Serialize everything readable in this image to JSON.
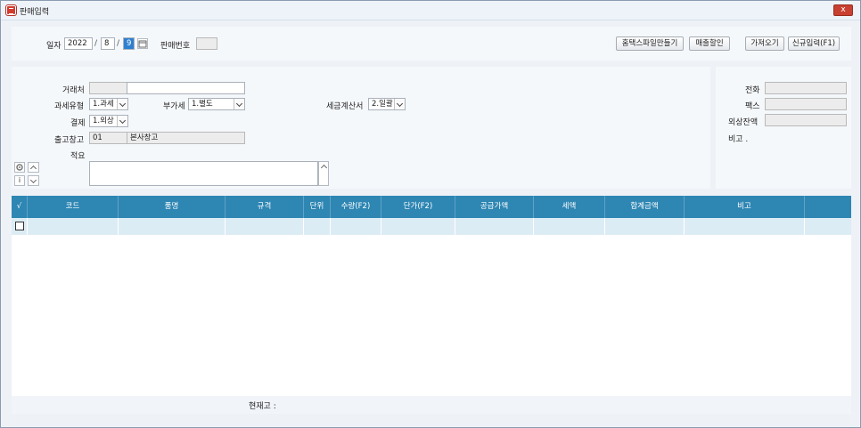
{
  "window": {
    "title": "판매입력",
    "close_label": "x"
  },
  "header": {
    "date_label": "일자",
    "year": "2022",
    "month": "8",
    "day": "9",
    "date_sep": "/",
    "sale_no_label": "판매번호",
    "sale_no_value": "",
    "buttons": {
      "homtax": "홈택스파일만들기",
      "discount": "매출할인",
      "fetch": "가져오기",
      "new_entry": "신규입력(F1)"
    }
  },
  "form": {
    "customer_label": "거래처",
    "customer_code": "",
    "customer_name": "",
    "tax_type_label": "과세유형",
    "tax_type_value": "1.과세",
    "vat_label": "부가세",
    "vat_value": "1.별도",
    "invoice_label": "세금계산서",
    "invoice_value": "2.일괄",
    "payment_label": "결제",
    "payment_value": "1.외상",
    "warehouse_label": "출고창고",
    "warehouse_code": "01",
    "warehouse_name": "본사창고",
    "memo_label": "적요",
    "memo_value": "",
    "settings_icon": "gear-icon",
    "info_label": "i"
  },
  "side": {
    "phone_label": "전화",
    "phone_value": "",
    "fax_label": "팩스",
    "fax_value": "",
    "balance_label": "외상잔액",
    "balance_value": "",
    "note_label": "비고 ."
  },
  "grid": {
    "check_header": "√",
    "columns": [
      "코드",
      "품명",
      "규격",
      "단위",
      "수량(F2)",
      "단가(F2)",
      "공급가액",
      "세액",
      "합계금액",
      "비고"
    ]
  },
  "footer": {
    "stock_label": "현재고 :"
  }
}
